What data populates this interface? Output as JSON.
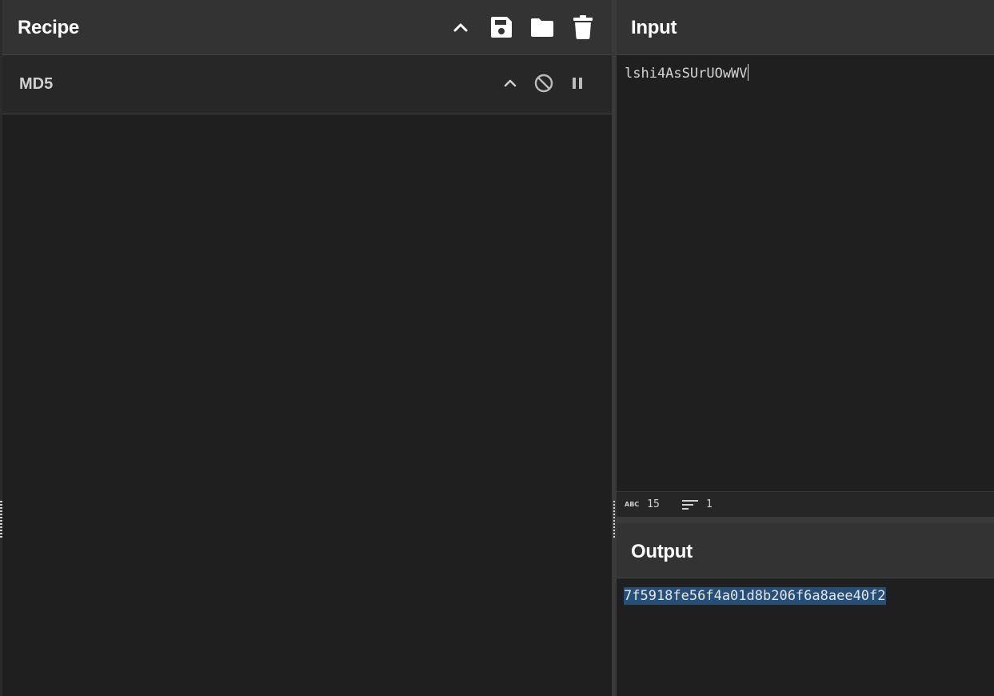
{
  "recipe": {
    "title": "Recipe",
    "actions": {
      "collapse": "chevron-up-icon",
      "save": "floppy-disk-icon",
      "load": "folder-icon",
      "clear": "trash-icon"
    },
    "operations": [
      {
        "name": "MD5",
        "actions": {
          "collapse": "chevron-up-icon",
          "disable": "block-icon",
          "breakpoint": "pause-icon"
        }
      }
    ]
  },
  "input": {
    "title": "Input",
    "value": "lshi4AsSUrUOwWV",
    "status": {
      "length_icon": "ABC",
      "length": "15",
      "lines": "1"
    }
  },
  "output": {
    "title": "Output",
    "value": "7f5918fe56f4a01d8b206f6a8aee40f2"
  },
  "colors": {
    "background": "#1f1f1f",
    "header": "#333333",
    "operation_row": "#272727",
    "selection": "#264f78",
    "text": "#ffffff"
  }
}
